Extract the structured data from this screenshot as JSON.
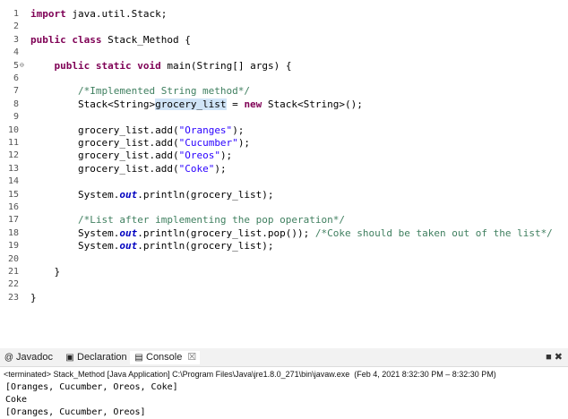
{
  "editor": {
    "lines": [
      {
        "n": "1",
        "tokens": [
          {
            "t": "import",
            "c": "kw"
          },
          {
            "t": " java.util.Stack;"
          }
        ]
      },
      {
        "n": "2",
        "tokens": []
      },
      {
        "n": "3",
        "tokens": [
          {
            "t": "public",
            "c": "kw"
          },
          {
            "t": " "
          },
          {
            "t": "class",
            "c": "kw"
          },
          {
            "t": " Stack_Method {"
          }
        ]
      },
      {
        "n": "4",
        "tokens": []
      },
      {
        "n": "5",
        "fold": true,
        "tokens": [
          {
            "t": "    "
          },
          {
            "t": "public",
            "c": "kw"
          },
          {
            "t": " "
          },
          {
            "t": "static",
            "c": "kw"
          },
          {
            "t": " "
          },
          {
            "t": "void",
            "c": "kw"
          },
          {
            "t": " main(String[] args) {"
          }
        ]
      },
      {
        "n": "6",
        "tokens": []
      },
      {
        "n": "7",
        "tokens": [
          {
            "t": "        "
          },
          {
            "t": "/*Implemented String method*/",
            "c": "cm"
          }
        ]
      },
      {
        "n": "8",
        "tokens": [
          {
            "t": "        Stack<String>"
          },
          {
            "t": "grocery_list",
            "c": "hl"
          },
          {
            "t": " = "
          },
          {
            "t": "new",
            "c": "kw"
          },
          {
            "t": " Stack<String>();"
          }
        ]
      },
      {
        "n": "9",
        "tokens": []
      },
      {
        "n": "10",
        "tokens": [
          {
            "t": "        grocery_list.add("
          },
          {
            "t": "\"Oranges\"",
            "c": "str"
          },
          {
            "t": ");"
          }
        ]
      },
      {
        "n": "11",
        "tokens": [
          {
            "t": "        grocery_list.add("
          },
          {
            "t": "\"Cucumber\"",
            "c": "str"
          },
          {
            "t": ");"
          }
        ]
      },
      {
        "n": "12",
        "tokens": [
          {
            "t": "        grocery_list.add("
          },
          {
            "t": "\"Oreos\"",
            "c": "str"
          },
          {
            "t": ");"
          }
        ]
      },
      {
        "n": "13",
        "tokens": [
          {
            "t": "        grocery_list.add("
          },
          {
            "t": "\"Coke\"",
            "c": "str"
          },
          {
            "t": ");"
          }
        ]
      },
      {
        "n": "14",
        "tokens": []
      },
      {
        "n": "15",
        "tokens": [
          {
            "t": "        System."
          },
          {
            "t": "out",
            "c": "fld"
          },
          {
            "t": ".println(grocery_list);"
          }
        ]
      },
      {
        "n": "16",
        "tokens": []
      },
      {
        "n": "17",
        "tokens": [
          {
            "t": "        "
          },
          {
            "t": "/*List after implementing the pop operation*/",
            "c": "cm"
          }
        ]
      },
      {
        "n": "18",
        "tokens": [
          {
            "t": "        System."
          },
          {
            "t": "out",
            "c": "fld"
          },
          {
            "t": ".println(grocery_list.pop()); "
          },
          {
            "t": "/*Coke should be taken out of the list*/",
            "c": "cm"
          }
        ]
      },
      {
        "n": "19",
        "tokens": [
          {
            "t": "        System."
          },
          {
            "t": "out",
            "c": "fld"
          },
          {
            "t": ".println(grocery_list);"
          }
        ]
      },
      {
        "n": "20",
        "tokens": []
      },
      {
        "n": "21",
        "tokens": [
          {
            "t": "    }"
          }
        ]
      },
      {
        "n": "22",
        "tokens": []
      },
      {
        "n": "23",
        "tokens": [
          {
            "t": "}"
          }
        ]
      }
    ]
  },
  "views": {
    "tabs": [
      {
        "label": "Javadoc",
        "icon": "@"
      },
      {
        "label": "Declaration",
        "icon": "▣"
      },
      {
        "label": "Console",
        "icon": "▤",
        "active": true,
        "close": "☒"
      }
    ],
    "controls": "■ ✖",
    "status": "<terminated> Stack_Method [Java Application] C:\\Program Files\\Java\\jre1.8.0_271\\bin\\javaw.exe  (Feb 4, 2021 8:32:30 PM – 8:32:30 PM)",
    "output": [
      "[Oranges, Cucumber, Oreos, Coke]",
      "Coke",
      "[Oranges, Cucumber, Oreos]"
    ]
  }
}
